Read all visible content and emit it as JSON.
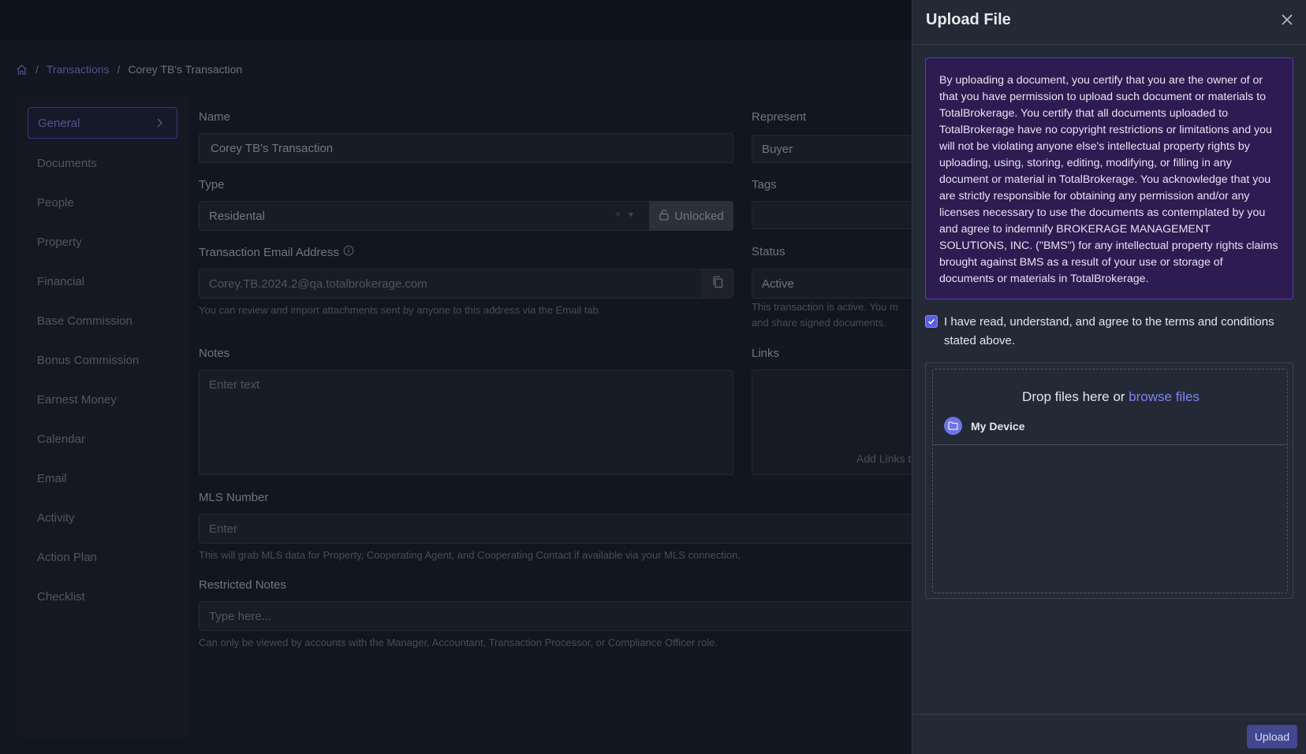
{
  "breadcrumb": {
    "items": [
      "Transactions",
      "Corey TB's Transaction"
    ],
    "sep": "/"
  },
  "sidebar": {
    "items": [
      {
        "label": "General",
        "active": true
      },
      {
        "label": "Documents"
      },
      {
        "label": "People"
      },
      {
        "label": "Property"
      },
      {
        "label": "Financial"
      },
      {
        "label": "Base Commission"
      },
      {
        "label": "Bonus Commission"
      },
      {
        "label": "Earnest Money"
      },
      {
        "label": "Calendar"
      },
      {
        "label": "Email"
      },
      {
        "label": "Activity"
      },
      {
        "label": "Action Plan"
      },
      {
        "label": "Checklist"
      }
    ]
  },
  "form": {
    "name_label": "Name",
    "name_value": "Corey TB's Transaction",
    "represent_label": "Represent",
    "represent_value": "Buyer",
    "type_label": "Type",
    "type_value": "Residental",
    "type_clear": "×",
    "type_arrow": "▾",
    "unlocked_label": "Unlocked",
    "tags_label": "Tags",
    "tags_value": "",
    "email_label": "Transaction Email Address",
    "email_value": "Corey.TB.2024.2@qa.totalbrokerage.com",
    "email_help": "You can review and import attachments sent by anyone to this address via the Email tab.",
    "status_label": "Status",
    "status_value": "Active",
    "status_help_1": "This transaction is active. You m",
    "status_help_2": "and share signed documents.",
    "notes_label": "Notes",
    "notes_placeholder": "Enter text",
    "links_label": "Links",
    "links_add": "Add Links t",
    "mls_label": "MLS Number",
    "mls_placeholder": "Enter",
    "mls_help": "This will grab MLS data for Property, Cooperating Agent, and Cooperating Contact if available via your MLS connection.",
    "restricted_label": "Restricted Notes",
    "restricted_placeholder": "Type here...",
    "restricted_help": "Can only be viewed by accounts with the Manager, Accountant, Transaction Processor, or Compliance Officer role."
  },
  "drawer": {
    "title": "Upload File",
    "notice": "By uploading a document, you certify that you are the owner of or that you have permission to upload such document or materials to TotalBrokerage. You certify that all documents uploaded to TotalBrokerage have no copyright restrictions or limitations and you will not be violating anyone else's intellectual property rights by uploading, using, storing, editing, modifying, or filling in any document or material in TotalBrokerage. You acknowledge that you are strictly responsible for obtaining any permission and/or any licenses necessary to use the documents as contemplated by you and agree to indemnify BROKERAGE MANAGEMENT SOLUTIONS, INC. (\"BMS\") for any intellectual property rights claims brought against BMS as a result of your use or storage of documents or materials in TotalBrokerage.",
    "agree_text": "I have read, understand, and agree to the terms and conditions stated above.",
    "agree_checked": true,
    "drop_text": "Drop files here or",
    "browse_text": "browse files",
    "source_label": "My Device",
    "upload_label": "Upload"
  },
  "colors": {
    "accent": "#5b5ed6",
    "notice_bg": "#2c1c52",
    "link": "#7d82f2"
  }
}
